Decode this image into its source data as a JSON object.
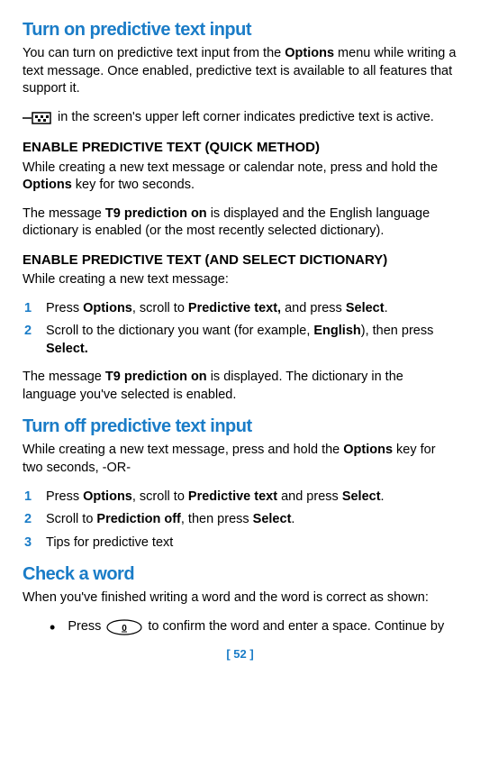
{
  "section1": {
    "title": "Turn on predictive text input",
    "intro_p1": "You can turn on predictive text input from the ",
    "intro_bold1": "Options",
    "intro_p2": " menu while writing a text message. Once enabled, predictive text is available to all features that support it.",
    "icon_line": " in the screen's upper left corner indicates predictive text is active."
  },
  "quick": {
    "heading": "ENABLE PREDICTIVE TEXT (QUICK METHOD)",
    "p1a": "While creating a new text message or calendar note, press and hold the ",
    "p1b": "Options",
    "p1c": " key for two seconds.",
    "p2a": "The message ",
    "p2b": "T9 prediction on",
    "p2c": " is displayed and the English language dictionary is enabled (or the most recently selected dictionary)."
  },
  "dict": {
    "heading": "ENABLE PREDICTIVE TEXT (AND SELECT DICTIONARY)",
    "intro": "While creating a new text message:",
    "steps": {
      "n1": "1",
      "s1_a": "Press ",
      "s1_b": "Options",
      "s1_c": ", scroll to ",
      "s1_d": "Predictive text,",
      "s1_e": " and press ",
      "s1_f": "Select",
      "s1_g": ".",
      "n2": "2",
      "s2_a": "Scroll to the dictionary you want (for example, ",
      "s2_b": "English",
      "s2_c": "), then press ",
      "s2_d": "Select."
    },
    "result_a": "The message ",
    "result_b": "T9 prediction on",
    "result_c": " is displayed. The dictionary in the language you've selected is enabled."
  },
  "section2": {
    "title": "Turn off predictive text input",
    "intro_a": "While creating a new text message, press and hold the ",
    "intro_b": "Options",
    "intro_c": " key for two seconds, -OR-",
    "steps": {
      "n1": "1",
      "s1_a": "Press ",
      "s1_b": "Options",
      "s1_c": ", scroll to ",
      "s1_d": "Predictive text",
      "s1_e": " and press ",
      "s1_f": "Select",
      "s1_g": ".",
      "n2": "2",
      "s2_a": "Scroll to ",
      "s2_b": "Prediction off",
      "s2_c": ", then press ",
      "s2_d": "Select",
      "s2_e": ".",
      "n3": "3",
      "s3": "Tips for predictive text"
    }
  },
  "section3": {
    "title": "Check a word",
    "intro": "When you've finished writing a word and the word is correct as shown:",
    "bullet_a": "Press",
    "bullet_b": "to confirm the word and enter a space. Continue by"
  },
  "page": "[ 52 ]"
}
